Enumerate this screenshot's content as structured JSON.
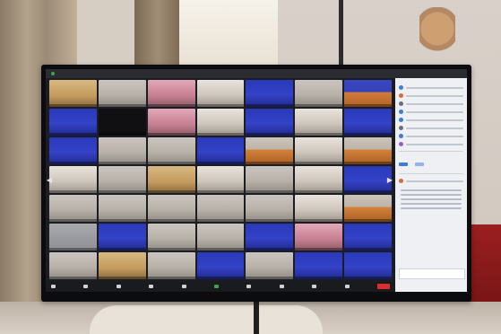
{
  "scene": {
    "tv": {
      "title_left": [
        "",
        ""
      ],
      "title_center": "",
      "title_right": "",
      "brand": ""
    },
    "gallery_tiles": [
      "t-warm",
      "t-room",
      "t-pink",
      "t-hall",
      "t-blue",
      "t-room",
      "t-orange",
      "t-blue",
      "t-dark",
      "t-pink",
      "t-hall",
      "t-blue",
      "t-hall",
      "t-blue",
      "t-blue",
      "t-room",
      "t-room",
      "t-blue",
      "t-monk",
      "t-hall",
      "t-monk",
      "t-hall",
      "t-room",
      "t-warm",
      "t-hall",
      "t-room",
      "t-hall",
      "t-blue",
      "t-room",
      "t-room",
      "t-room",
      "t-room",
      "t-room",
      "t-hall",
      "t-monk",
      "t-gray",
      "t-blue",
      "t-room",
      "t-room",
      "t-blue",
      "t-pink",
      "t-blue",
      "t-room",
      "t-warm",
      "t-room",
      "t-blue",
      "t-room",
      "t-blue",
      "t-blue"
    ],
    "panel": {
      "title": "",
      "participant_colors": [
        "#3c7be0",
        "#e0663c",
        "#6b6f78",
        "#3c7be0",
        "#3c7be0",
        "#6b6f78",
        "#3c7be0",
        "#9b5ad6"
      ]
    },
    "colors": {
      "end_button": "#d7302a",
      "zoom_accent": "#3c7be0"
    }
  }
}
